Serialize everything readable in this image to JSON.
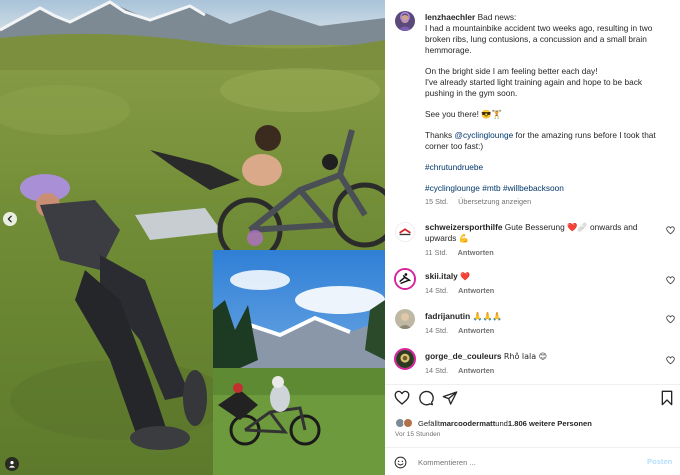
{
  "post": {
    "author": "lenzhaechler",
    "caption_intro": "Bad news:",
    "caption_line1": "I had a mountainbike accident two weeks ago, resulting in two broken ribs, lung contusions, a concussion and a small brain hemmorage.",
    "caption_line2": "On the bright side I am feeling better each day!",
    "caption_line3": "I've already started light training again and hope to be back pushing in the gym soon.",
    "caption_line4": "See you there! 😎🏋",
    "caption_thanks_pre": "Thanks ",
    "caption_mention": "@cyclinglounge",
    "caption_thanks_post": " for the amazing runs before I took that corner too fast:)",
    "hashtag_line1": "#chrutundruebe",
    "hashtags": [
      "#cyclinglounge",
      "#mtb",
      "#willbebacksoon"
    ],
    "time": "15 Std.",
    "translate_label": "Übersetzung anzeigen"
  },
  "comments": [
    {
      "user": "schweizersporthilfe",
      "text": "Gute Besserung ❤️🩹 onwards and upwards 💪",
      "time": "11 Std.",
      "reply": "Antworten",
      "avatar": "sporthilfe-logo"
    },
    {
      "user": "skii.italy",
      "text": "❤️",
      "time": "14 Std.",
      "reply": "Antworten",
      "avatar": "skier-logo"
    },
    {
      "user": "fadrijanutin",
      "text": "🙏🙏🙏",
      "time": "14 Std.",
      "reply": "Antworten",
      "avatar": "photo"
    },
    {
      "user": "gorge_de_couleurs",
      "text": "Rhô lala 😊",
      "time": "14 Std.",
      "reply": "Antworten",
      "avatar": "photo"
    }
  ],
  "likes": {
    "prefix": "Gefällt ",
    "user": "marcoodermatt",
    "middle": " und ",
    "count": "1.806 weitere Personen"
  },
  "posted_ago": "Vor 15 Stunden",
  "compose": {
    "placeholder": "Kommentieren ...",
    "post_label": "Posten"
  },
  "icons": {
    "like": "heart-icon",
    "comment": "comment-icon",
    "share": "paper-plane-icon",
    "save": "bookmark-icon",
    "emoji": "smiley-icon",
    "prev": "chevron-left-icon",
    "tag": "person-tag-icon"
  },
  "colors": {
    "link": "#00376b",
    "muted": "#737373",
    "heart": "#ed4956",
    "post_button_disabled": "#b2dffc"
  }
}
